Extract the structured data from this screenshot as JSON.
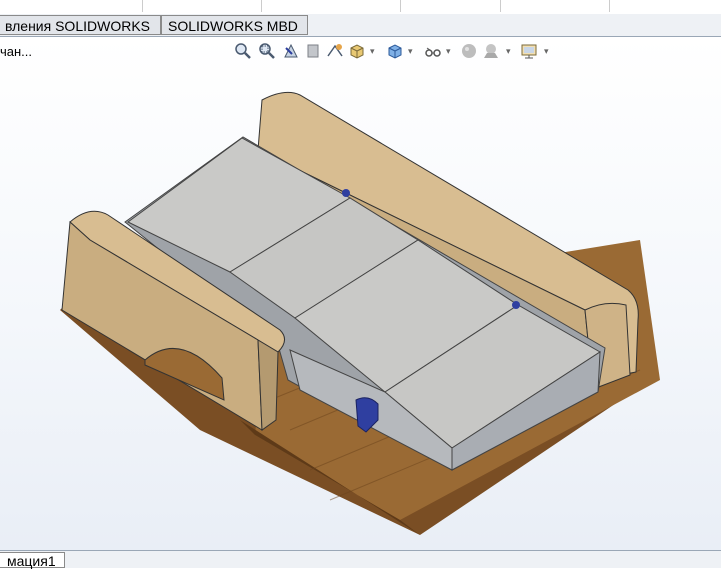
{
  "tabs": [
    {
      "label": "вления SOLIDWORKS"
    },
    {
      "label": "SOLIDWORKS MBD"
    }
  ],
  "status_text": "чан...",
  "toolbar": {
    "icons": [
      "zoom-to-fit-icon",
      "zoom-area-icon",
      "previous-view-icon",
      "section-view-icon",
      "dynamic-annotation-icon",
      "view-orientation-icon",
      "display-style-icon",
      "hide-show-items-icon",
      "edit-appearance-icon",
      "apply-scene-icon",
      "view-settings-icon"
    ]
  },
  "bottom_tab": {
    "label": "мация1"
  },
  "colors": {
    "tan": "#d8bd91",
    "tan_dark": "#b49a70",
    "wood": "#8a5a2a",
    "cushion": "#c9c9c7",
    "frame": "#a9adb3",
    "blue_part": "#2f3fa0"
  }
}
